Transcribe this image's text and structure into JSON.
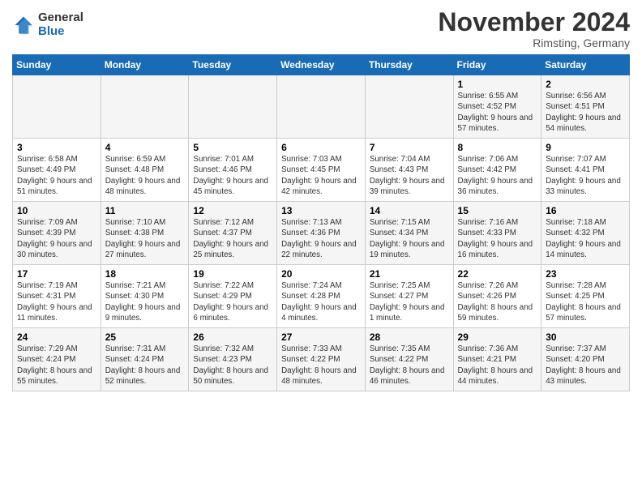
{
  "header": {
    "logo_general": "General",
    "logo_blue": "Blue",
    "month_title": "November 2024",
    "location": "Rimsting, Germany"
  },
  "days_of_week": [
    "Sunday",
    "Monday",
    "Tuesday",
    "Wednesday",
    "Thursday",
    "Friday",
    "Saturday"
  ],
  "weeks": [
    [
      {
        "day": "",
        "info": ""
      },
      {
        "day": "",
        "info": ""
      },
      {
        "day": "",
        "info": ""
      },
      {
        "day": "",
        "info": ""
      },
      {
        "day": "",
        "info": ""
      },
      {
        "day": "1",
        "info": "Sunrise: 6:55 AM\nSunset: 4:52 PM\nDaylight: 9 hours and 57 minutes."
      },
      {
        "day": "2",
        "info": "Sunrise: 6:56 AM\nSunset: 4:51 PM\nDaylight: 9 hours and 54 minutes."
      }
    ],
    [
      {
        "day": "3",
        "info": "Sunrise: 6:58 AM\nSunset: 4:49 PM\nDaylight: 9 hours and 51 minutes."
      },
      {
        "day": "4",
        "info": "Sunrise: 6:59 AM\nSunset: 4:48 PM\nDaylight: 9 hours and 48 minutes."
      },
      {
        "day": "5",
        "info": "Sunrise: 7:01 AM\nSunset: 4:46 PM\nDaylight: 9 hours and 45 minutes."
      },
      {
        "day": "6",
        "info": "Sunrise: 7:03 AM\nSunset: 4:45 PM\nDaylight: 9 hours and 42 minutes."
      },
      {
        "day": "7",
        "info": "Sunrise: 7:04 AM\nSunset: 4:43 PM\nDaylight: 9 hours and 39 minutes."
      },
      {
        "day": "8",
        "info": "Sunrise: 7:06 AM\nSunset: 4:42 PM\nDaylight: 9 hours and 36 minutes."
      },
      {
        "day": "9",
        "info": "Sunrise: 7:07 AM\nSunset: 4:41 PM\nDaylight: 9 hours and 33 minutes."
      }
    ],
    [
      {
        "day": "10",
        "info": "Sunrise: 7:09 AM\nSunset: 4:39 PM\nDaylight: 9 hours and 30 minutes."
      },
      {
        "day": "11",
        "info": "Sunrise: 7:10 AM\nSunset: 4:38 PM\nDaylight: 9 hours and 27 minutes."
      },
      {
        "day": "12",
        "info": "Sunrise: 7:12 AM\nSunset: 4:37 PM\nDaylight: 9 hours and 25 minutes."
      },
      {
        "day": "13",
        "info": "Sunrise: 7:13 AM\nSunset: 4:36 PM\nDaylight: 9 hours and 22 minutes."
      },
      {
        "day": "14",
        "info": "Sunrise: 7:15 AM\nSunset: 4:34 PM\nDaylight: 9 hours and 19 minutes."
      },
      {
        "day": "15",
        "info": "Sunrise: 7:16 AM\nSunset: 4:33 PM\nDaylight: 9 hours and 16 minutes."
      },
      {
        "day": "16",
        "info": "Sunrise: 7:18 AM\nSunset: 4:32 PM\nDaylight: 9 hours and 14 minutes."
      }
    ],
    [
      {
        "day": "17",
        "info": "Sunrise: 7:19 AM\nSunset: 4:31 PM\nDaylight: 9 hours and 11 minutes."
      },
      {
        "day": "18",
        "info": "Sunrise: 7:21 AM\nSunset: 4:30 PM\nDaylight: 9 hours and 9 minutes."
      },
      {
        "day": "19",
        "info": "Sunrise: 7:22 AM\nSunset: 4:29 PM\nDaylight: 9 hours and 6 minutes."
      },
      {
        "day": "20",
        "info": "Sunrise: 7:24 AM\nSunset: 4:28 PM\nDaylight: 9 hours and 4 minutes."
      },
      {
        "day": "21",
        "info": "Sunrise: 7:25 AM\nSunset: 4:27 PM\nDaylight: 9 hours and 1 minute."
      },
      {
        "day": "22",
        "info": "Sunrise: 7:26 AM\nSunset: 4:26 PM\nDaylight: 8 hours and 59 minutes."
      },
      {
        "day": "23",
        "info": "Sunrise: 7:28 AM\nSunset: 4:25 PM\nDaylight: 8 hours and 57 minutes."
      }
    ],
    [
      {
        "day": "24",
        "info": "Sunrise: 7:29 AM\nSunset: 4:24 PM\nDaylight: 8 hours and 55 minutes."
      },
      {
        "day": "25",
        "info": "Sunrise: 7:31 AM\nSunset: 4:24 PM\nDaylight: 8 hours and 52 minutes."
      },
      {
        "day": "26",
        "info": "Sunrise: 7:32 AM\nSunset: 4:23 PM\nDaylight: 8 hours and 50 minutes."
      },
      {
        "day": "27",
        "info": "Sunrise: 7:33 AM\nSunset: 4:22 PM\nDaylight: 8 hours and 48 minutes."
      },
      {
        "day": "28",
        "info": "Sunrise: 7:35 AM\nSunset: 4:22 PM\nDaylight: 8 hours and 46 minutes."
      },
      {
        "day": "29",
        "info": "Sunrise: 7:36 AM\nSunset: 4:21 PM\nDaylight: 8 hours and 44 minutes."
      },
      {
        "day": "30",
        "info": "Sunrise: 7:37 AM\nSunset: 4:20 PM\nDaylight: 8 hours and 43 minutes."
      }
    ]
  ]
}
